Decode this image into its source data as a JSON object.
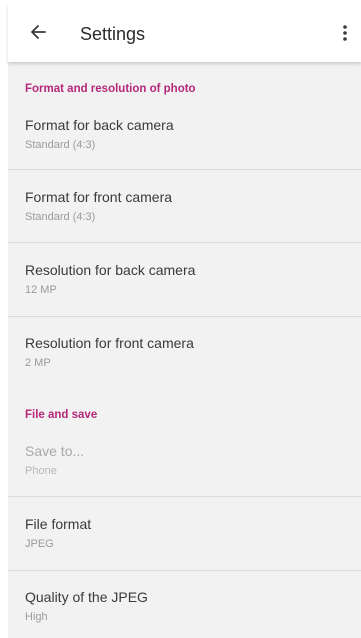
{
  "app_bar": {
    "title": "Settings",
    "back_icon": "arrow-left-icon",
    "overflow_icon": "more-vert-icon"
  },
  "sections": [
    {
      "header": "Format and resolution of photo",
      "items": [
        {
          "label": "Format for back camera",
          "value": "Standard (4:3)"
        },
        {
          "label": "Format for front camera",
          "value": "Standard (4:3)"
        },
        {
          "label": "Resolution for back camera",
          "value": "12 MP"
        },
        {
          "label": "Resolution for front camera",
          "value": "2 MP"
        }
      ]
    },
    {
      "header": "File and save",
      "items": [
        {
          "label": "Save to...",
          "value": "Phone",
          "enabled": false
        },
        {
          "label": "File format",
          "value": "JPEG"
        },
        {
          "label": "Quality of the JPEG",
          "value": "High"
        }
      ]
    }
  ],
  "colors": {
    "accent": "#b5287a",
    "background": "#f2f2f2",
    "app_bar": "#ffffff",
    "primary_text": "#3a3a3a",
    "secondary_text": "#9a9a9a",
    "divider": "#dcdcdc"
  }
}
